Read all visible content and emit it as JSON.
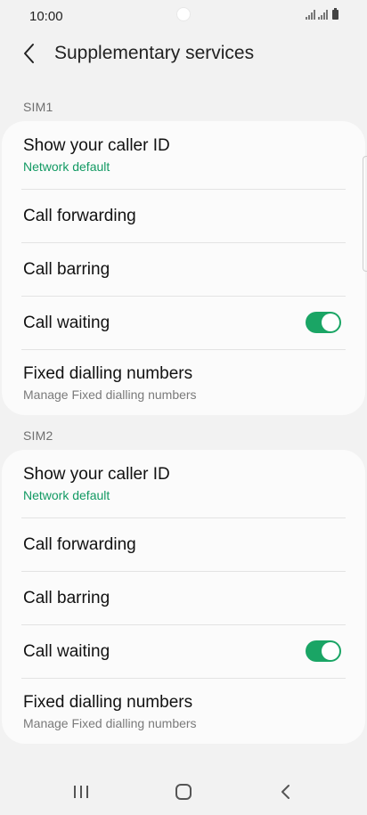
{
  "status_bar": {
    "time": "10:00"
  },
  "header": {
    "title": "Supplementary services"
  },
  "sections": [
    {
      "label": "SIM1",
      "items": [
        {
          "title": "Show your caller ID",
          "subtitle": "Network default"
        },
        {
          "title": "Call forwarding"
        },
        {
          "title": "Call barring"
        },
        {
          "title": "Call waiting",
          "toggle": true
        },
        {
          "title": "Fixed dialling numbers",
          "subtitle": "Manage Fixed dialling numbers"
        }
      ]
    },
    {
      "label": "SIM2",
      "items": [
        {
          "title": "Show your caller ID",
          "subtitle": "Network default"
        },
        {
          "title": "Call forwarding"
        },
        {
          "title": "Call barring"
        },
        {
          "title": "Call waiting",
          "toggle": true
        },
        {
          "title": "Fixed dialling numbers",
          "subtitle": "Manage Fixed dialling numbers"
        }
      ]
    }
  ],
  "nav_bar": {
    "recents_icon": "recents-icon",
    "home_icon": "home-icon",
    "back_icon": "back-icon"
  },
  "colors": {
    "accent": "#1aa565",
    "subtitle_green": "#129a63",
    "background": "#f2f2f2",
    "card": "#fbfbfb"
  }
}
